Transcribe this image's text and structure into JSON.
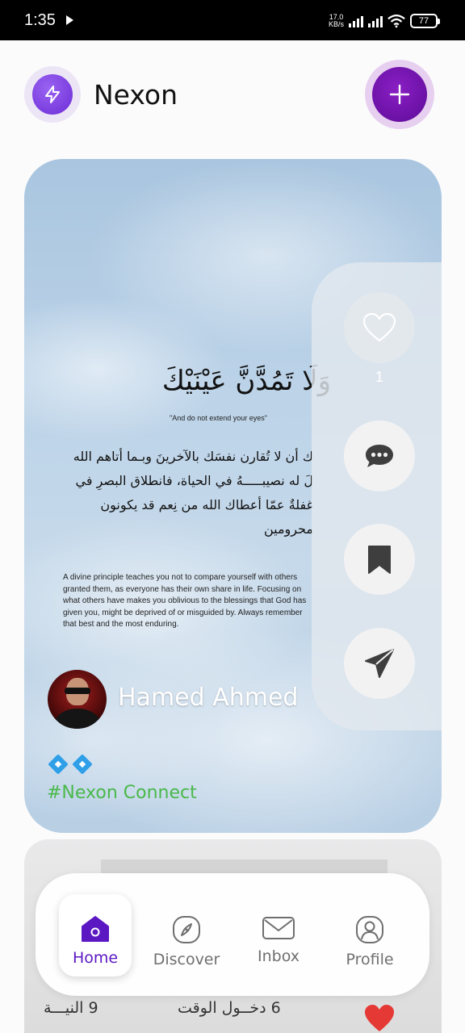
{
  "status_bar": {
    "time": "1:35",
    "net_speed_value": "17.0",
    "net_speed_unit": "KB/s",
    "battery": "77"
  },
  "header": {
    "app_name": "Nexon",
    "logo_icon": "lightning-bolt-icon",
    "add_icon": "plus-icon",
    "accent": "#6c2cd6"
  },
  "post": {
    "arabic_title": "وَلَا تَمُدَّنَّ عَيْنَيْكَ",
    "english_quote": "\"And do not extend your eyes\"",
    "arabic_body": "ك أن لا تُقارن نفسَك بالآخرينَ وبـما أتاهم الله\nلَ له نصيبـــــهُ في الحياة، فانطلاق البصرِ في\nغفلةٌ عمّا أعطاك الله من نِعم قد يكونون محرومين\nفيها...",
    "english_body": "A divine principle teaches you not to compare yourself with others granted them, as everyone has their own share in life. Focusing on what others have makes you oblivious to the blessings that God has given you, might be deprived of or misguided by. Always remember that best and the most enduring.",
    "author": "Hamed Ahmed",
    "emoji_line": "diamond-emoji diamond-emoji",
    "hashtag": "#Nexon Connect",
    "like_count": "1",
    "hashtag_color": "#49b84a"
  },
  "actions": {
    "like_icon": "heart-outline-icon",
    "comment_icon": "chat-bubble-icon",
    "save_icon": "bookmark-icon",
    "share_icon": "send-icon"
  },
  "next_post": {
    "text_left": "9 النيـــة",
    "text_right": "6 دخــول الوقت"
  },
  "nav": {
    "items": [
      {
        "label": "Home",
        "icon": "home-icon",
        "active": true
      },
      {
        "label": "Discover",
        "icon": "compass-icon",
        "active": false
      },
      {
        "label": "Inbox",
        "icon": "mail-icon",
        "active": false
      },
      {
        "label": "Profile",
        "icon": "profile-icon",
        "active": false
      }
    ]
  }
}
